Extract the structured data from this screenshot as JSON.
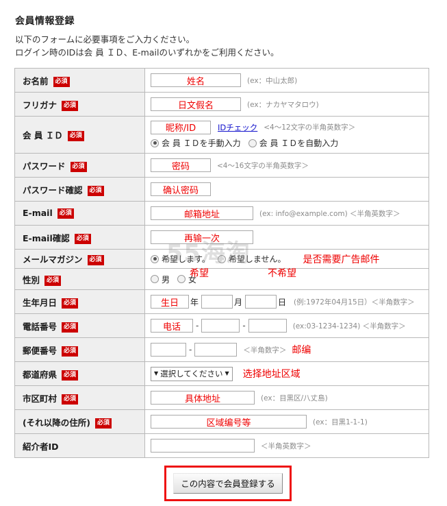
{
  "header": {
    "title": "会員情報登録",
    "intro_line1": "以下のフォームに必要事項をご入力ください。",
    "intro_line2": "ログイン時のIDは会 員 ＩＤ、E-mailのいずれかをご利用ください。"
  },
  "watermark": "55海淘",
  "required_badge": "必須",
  "rows": {
    "name": {
      "label": "お名前",
      "value": "姓名",
      "hint": "(ex：中山太郎)"
    },
    "furigana": {
      "label": "フリガナ",
      "value": "日文假名",
      "hint": "(ex：ナカヤマタロウ)"
    },
    "member_id": {
      "label": "会 員 ＩＤ",
      "value": "昵称/ID",
      "check_link": "IDチェック",
      "hint": "<4～12文字の半角英数字＞",
      "radio_manual": "会 員 ＩＤを手動入力",
      "radio_auto": "会 員 ＩＤを自動入力",
      "selected": "manual"
    },
    "password": {
      "label": "パスワード",
      "value": "密码",
      "hint": "<4～16文字の半角英数字＞"
    },
    "password_confirm": {
      "label": "パスワード確認",
      "value": "确认密码"
    },
    "email": {
      "label": "E-mail",
      "value": "邮箱地址",
      "hint": "(ex: info@example.com) ＜半角英数字＞"
    },
    "email_confirm": {
      "label": "E-mail確認",
      "value": "再输一次"
    },
    "mail_magazine": {
      "label": "メールマガジン",
      "radio_yes": "希望します。",
      "radio_no": "希望しません。",
      "selected": "yes",
      "anno_main": "是否需要广告邮件",
      "anno_yes": "希望",
      "anno_no": "不希望"
    },
    "gender": {
      "label": "性別",
      "radio_male": "男",
      "radio_female": "女",
      "selected": ""
    },
    "birthday": {
      "label": "生年月日",
      "year_value": "生日",
      "year_unit": "年",
      "month_value": "",
      "month_unit": "月",
      "day_value": "",
      "day_unit": "日",
      "hint": "(例:1972年04月15日）＜半角数字＞"
    },
    "phone": {
      "label": "電話番号",
      "part1": "电话",
      "part2": "",
      "part3": "",
      "separator": "-",
      "hint": "(ex:03-1234-1234) ＜半角数字＞"
    },
    "postal": {
      "label": "郵便番号",
      "part1": "",
      "part2": "",
      "separator": "-",
      "hint": "＜半角数字＞",
      "anno": "邮编"
    },
    "prefecture": {
      "label": "都道府県",
      "select_value": "選択してください",
      "caret": "▼",
      "anno": "选择地址区域"
    },
    "city": {
      "label": "市区町村",
      "value": "具体地址",
      "hint": "(ex：目黒区/八丈島)"
    },
    "address_rest": {
      "label": "(それ以降の住所)",
      "value": "区域编号等",
      "hint": "(ex：目黒1-1-1)"
    },
    "referrer_id": {
      "label": "紹介者ID",
      "value": "",
      "hint": "＜半角英数字＞"
    }
  },
  "submit": {
    "label": "この内容で会員登録する"
  },
  "colors": {
    "required_badge_bg": "#cc0000",
    "annotation": "#ee0000",
    "label_bg": "#efefef",
    "border": "#b9b9b9",
    "link": "#1111cc",
    "highlight_box": "#ee1111"
  }
}
